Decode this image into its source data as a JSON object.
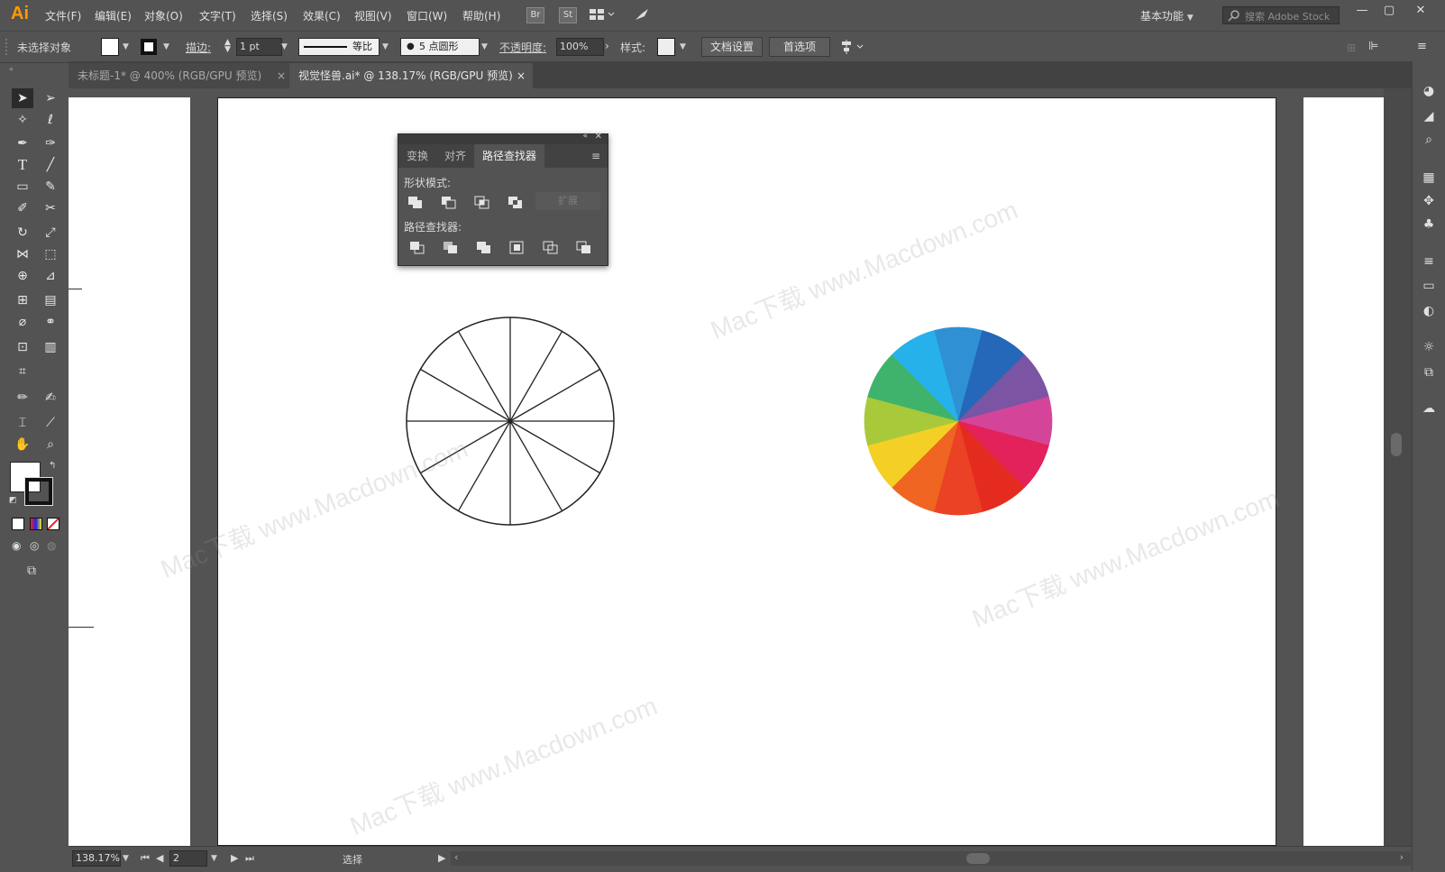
{
  "app": {
    "logo": "Ai"
  },
  "menu": [
    "文件(F)",
    "编辑(E)",
    "对象(O)",
    "文字(T)",
    "选择(S)",
    "效果(C)",
    "视图(V)",
    "窗口(W)",
    "帮助(H)"
  ],
  "badges": {
    "bridge": "Br",
    "stock": "St"
  },
  "workspace": {
    "label": "基本功能"
  },
  "search": {
    "placeholder": "搜索 Adobe Stock"
  },
  "window_controls": {
    "minimize": "—",
    "maximize": "▢",
    "close": "✕"
  },
  "control_bar": {
    "selection_status": "未选择对象",
    "stroke_label": "描边:",
    "stroke_value": "1 pt",
    "stroke_profile": "等比",
    "brush_value": "5 点圆形",
    "opacity_label": "不透明度:",
    "opacity_value": "100%",
    "style_label": "样式:",
    "doc_setup_button": "文档设置",
    "preferences_button": "首选项"
  },
  "tabs": [
    {
      "label": "未标题-1* @ 400% (RGB/GPU 预览)",
      "close": "×",
      "active": false
    },
    {
      "label": "视觉怪兽.ai* @ 138.17% (RGB/GPU 预览)",
      "close": "×",
      "active": true
    }
  ],
  "pathfinder": {
    "tabs": [
      "变换",
      "对齐",
      "路径查找器"
    ],
    "active_tab": "路径查找器",
    "shape_modes_label": "形状模式:",
    "pathfinders_label": "路径查找器:",
    "expand_button": "扩展"
  },
  "artwork": {
    "outline_wheel_segments": 12,
    "color_wheel": [
      "#2f90d4",
      "#2567b8",
      "#7b54a4",
      "#d4459a",
      "#e3215a",
      "#e52b20",
      "#eb4124",
      "#ef6521",
      "#f4d027",
      "#a8c93a",
      "#3fb36b",
      "#26b1ea"
    ]
  },
  "status": {
    "zoom": "138.17%",
    "artboard_number": "2",
    "tool_status": "选择"
  },
  "watermark": "Mac下载 www.Macdown.com"
}
